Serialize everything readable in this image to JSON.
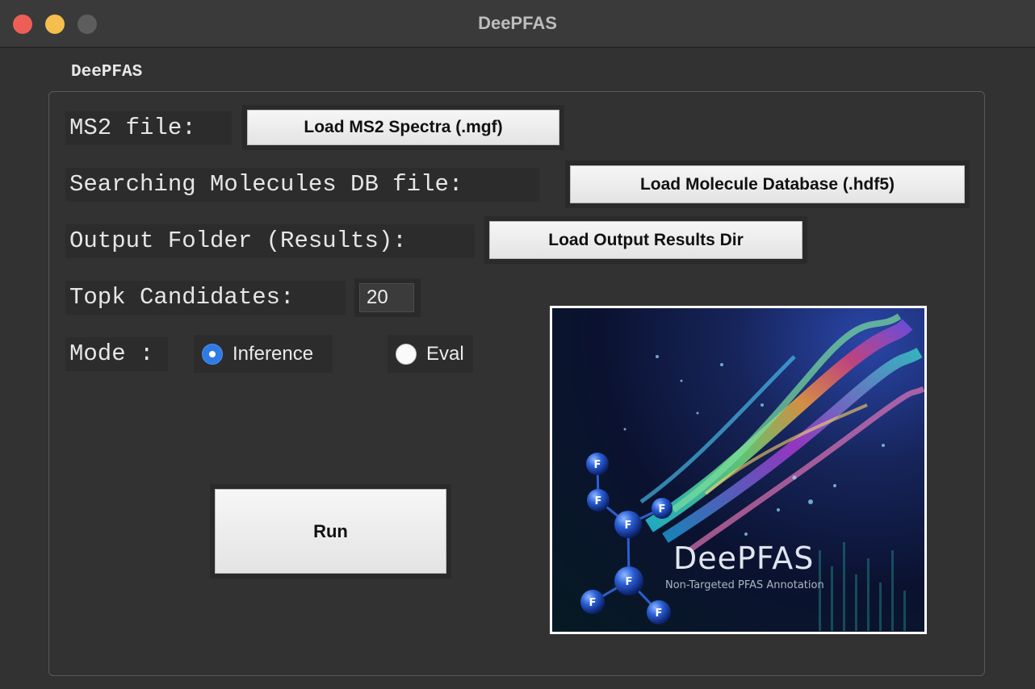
{
  "window": {
    "title": "DeePFAS"
  },
  "frame": {
    "label": "DeePFAS"
  },
  "ms2": {
    "label": "MS2 file:",
    "button": "Load MS2 Spectra (.mgf)"
  },
  "db": {
    "label": "Searching Molecules DB file:",
    "button": "Load Molecule Database (.hdf5)"
  },
  "output": {
    "label": "Output Folder (Results):",
    "button": "Load Output Results Dir"
  },
  "topk": {
    "label": "Topk Candidates:",
    "value": "20"
  },
  "mode": {
    "label": "Mode :",
    "options": [
      {
        "label": "Inference",
        "selected": true
      },
      {
        "label": "Eval",
        "selected": false
      }
    ]
  },
  "run": {
    "label": "Run"
  },
  "logo": {
    "title": "DeePFAS",
    "subtitle": "Non-Targeted PFAS Annotation",
    "atom_symbol": "F"
  },
  "colors": {
    "accent": "#2f7ae5",
    "background": "#323232"
  }
}
